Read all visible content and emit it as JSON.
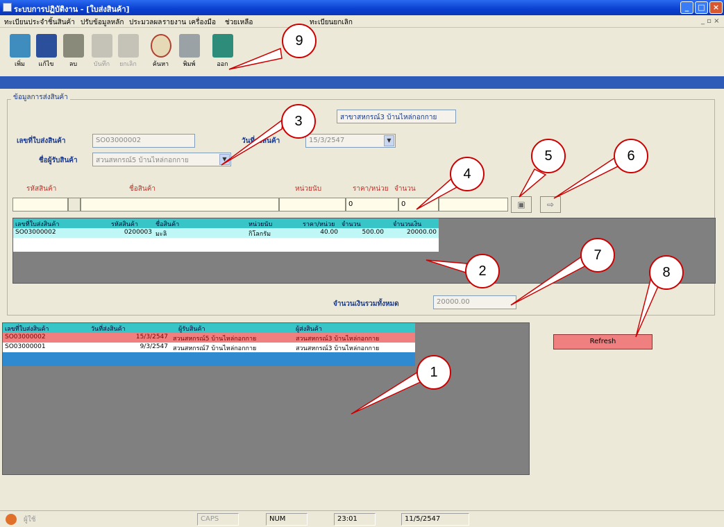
{
  "window": {
    "title": "ระบบการปฏิบัติงาน - [ใบส่งสินค้า]"
  },
  "menu": [
    "ทะเบียนประจำชิ้นสินค้า",
    "ปรับข้อมูลหลัก",
    "ประมวลผล",
    "รายงาน",
    "เครื่องมือ",
    "ช่วยเหลือ",
    "ทะเบียนยกเลิก"
  ],
  "toolbar": {
    "add": "เพิ่ม",
    "edit": "แก้ไข",
    "delete": "ลบ",
    "save": "บันทึก",
    "cancel": "ยกเลิก",
    "search": "ค้นหา",
    "print": "พิมพ์",
    "exit": "ออก"
  },
  "form": {
    "group_title": "ข้อมูลการส่งสินค้า",
    "branch": "สาขาสหกรณ์3 บ้านไหล่กอกกาย",
    "so_label": "เลขที่ใบส่งสินค้า",
    "so_value": "SO03000002",
    "date_label": "วันที่ส่งสินค้า",
    "date_value": "15/3/2547",
    "receiver_label": "ชื่อผู้รับสินค้า",
    "receiver_value": "สวนสหกรณ์5 บ้านไหล่กอกกาย"
  },
  "entry": {
    "labels": [
      "รหัสสินค้า",
      "ชื่อสินค้า",
      "หน่วยนับ",
      "ราคา/หน่วย",
      "จำนวน"
    ],
    "price": "0",
    "qty": "0"
  },
  "detail_grid": {
    "headers": [
      "เลขที่ใบส่งสินค้า",
      "รหัสสินค้า",
      "ชื่อสินค้า",
      "หน่วยนับ",
      "ราคา/หน่วย",
      "จำนวน",
      "จำนวนเงิน"
    ],
    "rows": [
      [
        "SO03000002",
        "0200003",
        "มะลิ",
        "กิโลกรัม",
        "40.00",
        "500.00",
        "20000.00"
      ]
    ]
  },
  "total": {
    "label": "จำนวนเงินรวมทั้งหมด",
    "value": "20000.00"
  },
  "list_grid": {
    "headers": [
      "เลขที่ใบส่งสินค้า",
      "วันที่ส่งสินค้า",
      "ผู้รับสินค้า",
      "ผู้ส่งสินค้า"
    ],
    "rows": [
      [
        "SO03000002",
        "15/3/2547",
        "สวนสหกรณ์5 บ้านไหล่กอกกาย",
        "สวนสหกรณ์3 บ้านไหล่กอกกาย"
      ],
      [
        "SO03000001",
        "9/3/2547",
        "สวนสหกรณ์7 บ้านไหล่กอกกาย",
        "สวนสหกรณ์3 บ้านไหล่กอกกาย"
      ]
    ]
  },
  "refresh": "Refresh",
  "status": {
    "user": "ผู้ใช้",
    "caps": "CAPS",
    "num": "NUM",
    "time": "23:01",
    "date": "11/5/2547"
  },
  "callouts": [
    "1",
    "2",
    "3",
    "4",
    "5",
    "6",
    "7",
    "8",
    "9"
  ],
  "colors": {
    "title": "#0a3fd0",
    "grid_header": "#37c5c7",
    "selected_row": "#f08080",
    "callout_border": "#cc0000"
  }
}
